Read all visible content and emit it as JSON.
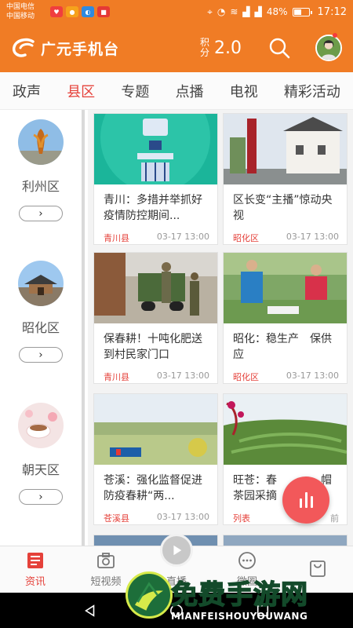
{
  "status_bar": {
    "carrier1": "中国电信",
    "carrier2": "中国移动",
    "battery": "48%",
    "time": "17:12"
  },
  "header": {
    "app_name": "广元手机台",
    "points_label": "积分",
    "points_value": "2.0",
    "brand_color": "#f07c25"
  },
  "tabs": [
    {
      "label": "政声"
    },
    {
      "label": "县区"
    },
    {
      "label": "专题"
    },
    {
      "label": "点播"
    },
    {
      "label": "电视"
    },
    {
      "label": "精彩活动"
    }
  ],
  "active_tab": "县区",
  "districts": [
    {
      "name": "利州区",
      "arrow": "›"
    },
    {
      "name": "昭化区",
      "arrow": "›"
    },
    {
      "name": "朝天区",
      "arrow": "›"
    }
  ],
  "cards": [
    {
      "title": "青川：多措并举抓好疫情防控期间...",
      "tag": "青川县",
      "time": "03-17 13:00"
    },
    {
      "title": "区长变“主播”惊动央视",
      "tag": "昭化区",
      "time": "03-17 13:00"
    },
    {
      "title": "保春耕！十吨化肥送到村民家门口",
      "tag": "青川县",
      "time": "03-17 13:00"
    },
    {
      "title": "昭化：稳生产　保供应",
      "tag": "昭化区",
      "time": "03-17 13:00"
    },
    {
      "title": "苍溪：强化监督促进防疫春耕“两...",
      "tag": "苍溪县",
      "time": "03-17 13:00"
    },
    {
      "title": "旺苍：春　　　　帽茶园采摘",
      "tag": "列表",
      "time": "　前"
    }
  ],
  "bottom_nav": [
    {
      "label": "资讯",
      "icon": "news-icon"
    },
    {
      "label": "短视频",
      "icon": "camera-icon"
    },
    {
      "label": "直播",
      "icon": "play-icon"
    },
    {
      "label": "微圈",
      "icon": "chat-icon"
    },
    {
      "label": "",
      "icon": "bag-icon"
    }
  ],
  "watermark": {
    "title": "免费手游网",
    "subtitle": "MIANFEISHOUYOUWANG"
  }
}
